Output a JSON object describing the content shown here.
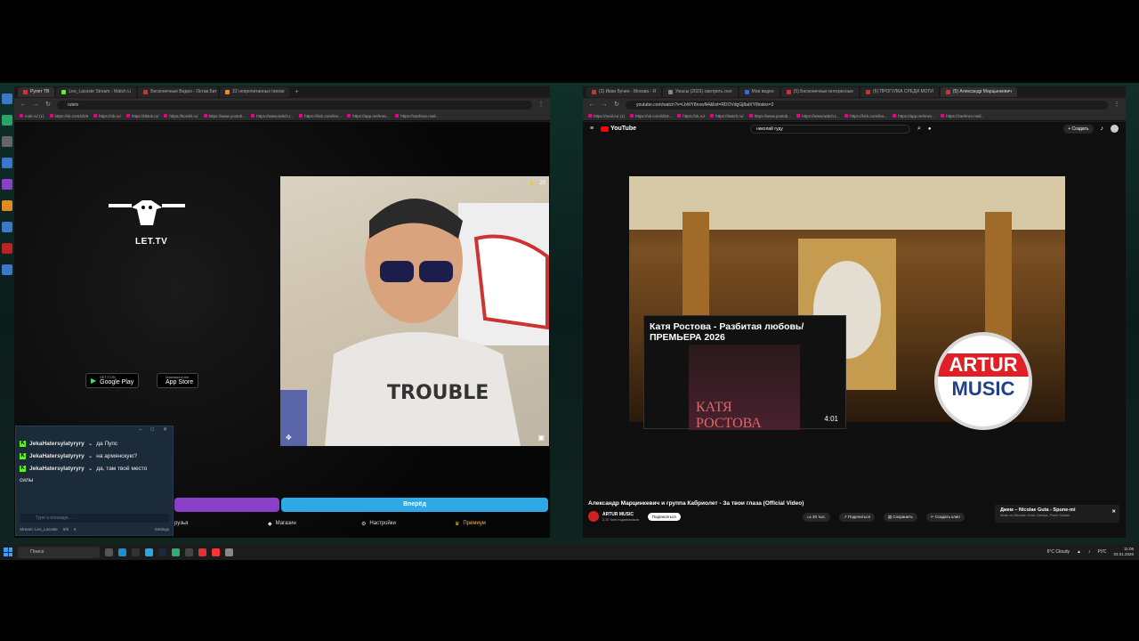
{
  "left_browser": {
    "tabs": [
      {
        "label": "Рулет ТВ",
        "active": true
      },
      {
        "label": "Leo_Lacoste Stream - Watch Li",
        "active": false
      },
      {
        "label": "Бесконечные Видео - Октав Бит",
        "active": false
      },
      {
        "label": "22 непрочитанных писем",
        "active": false
      }
    ],
    "url": "ruletv",
    "bookmarks": [
      "mail.ru/ (1)",
      "https://vk.com/id19",
      "https://ok.ru/",
      "https://tiktok.ru/",
      "https://kordel.ru/",
      "https://www.youtub...",
      "https://www.twitch.t...",
      "https://kick.com/leo...",
      "https://app.reshnex...",
      "https://zaehrun.mail..."
    ],
    "ruletv": {
      "logo_text": "LET.TV",
      "google_play_small": "GET IT ON",
      "google_play": "Google Play",
      "app_store_small": "Download on the",
      "app_store": "App Store",
      "cam_count": "20",
      "blue_button": "Вперёд",
      "nav": [
        "рузья",
        "Магазин",
        "Настройки",
        "Премиум"
      ]
    },
    "chat": {
      "messages": [
        {
          "user": "JekaHatersylatyryry",
          "text": "да Пупс"
        },
        {
          "user": "JekaHatersylatyryry",
          "text": "на армянскую?"
        },
        {
          "user": "JekaHatersylatyryry",
          "text": "да, там твоё место"
        }
      ],
      "continuation": "силы",
      "input_placeholder": "Type a message...",
      "footer_stream": "Stream: Leo_Lacoste",
      "footer_count1": "0/5",
      "footer_count2": "5",
      "footer_settings": "Settings"
    }
  },
  "right_browser": {
    "tabs": [
      {
        "label": "(3) Иван Бучин - Москва - Я",
        "active": false
      },
      {
        "label": "Ужасы (2023) смотреть онл",
        "active": false
      },
      {
        "label": "Мои видео",
        "active": false
      },
      {
        "label": "(5) Бесконечные интересные",
        "active": false
      },
      {
        "label": "(5) ПРОГУЛКА СРЕДИ МОГИ",
        "active": false
      },
      {
        "label": "(5) Александр Марцынкевич",
        "active": true
      }
    ],
    "url": "youtube.com/watch?v=LbWY8nxwN4&list=RDOVdgGj8atXY8index=2",
    "bookmarks": [
      "https://mail.ru/ (1)",
      "https://vk.com/id19...",
      "https://ok.ru/",
      "https://twitch.ru/",
      "https://www.youtub...",
      "https://www.twitch.t...",
      "https://kick.com/leo...",
      "https://app.reshnex...",
      "https://zaehrun.mail..."
    ],
    "youtube": {
      "logo": "YouTube",
      "search": "николай гуду",
      "create": "+ Создать",
      "card_title": "Катя Ростова - Разбитая любовь/ ПРЕМЬЕРА 2026",
      "card_poster_text": "КАТЯ РОСТОВА",
      "card_duration": "4:01",
      "artur_line1": "ARTUR",
      "artur_line2": "MUSIC",
      "video_title": "Александр Марцинкевич и группа Кабриолет - За твои глаза (Official Video)",
      "channel": "ARTUR MUSIC",
      "subscribers": "2,37 млн подписчиков",
      "subscribe": "Подписаться",
      "likes": "20 тыс.",
      "share": "Поделиться",
      "save": "Сохранить",
      "clip": "Создать клип",
      "notif_title": "Джем – Nicolae Guta - Spune-mi",
      "notif_sub": "Микс из Nicolae Guta, Denisa, Florin Salam"
    }
  },
  "taskbar": {
    "search": "Поиск",
    "weather": "6°C Cloudy",
    "lang": "РУС",
    "time": "11:08",
    "date": "03.01.2026"
  }
}
